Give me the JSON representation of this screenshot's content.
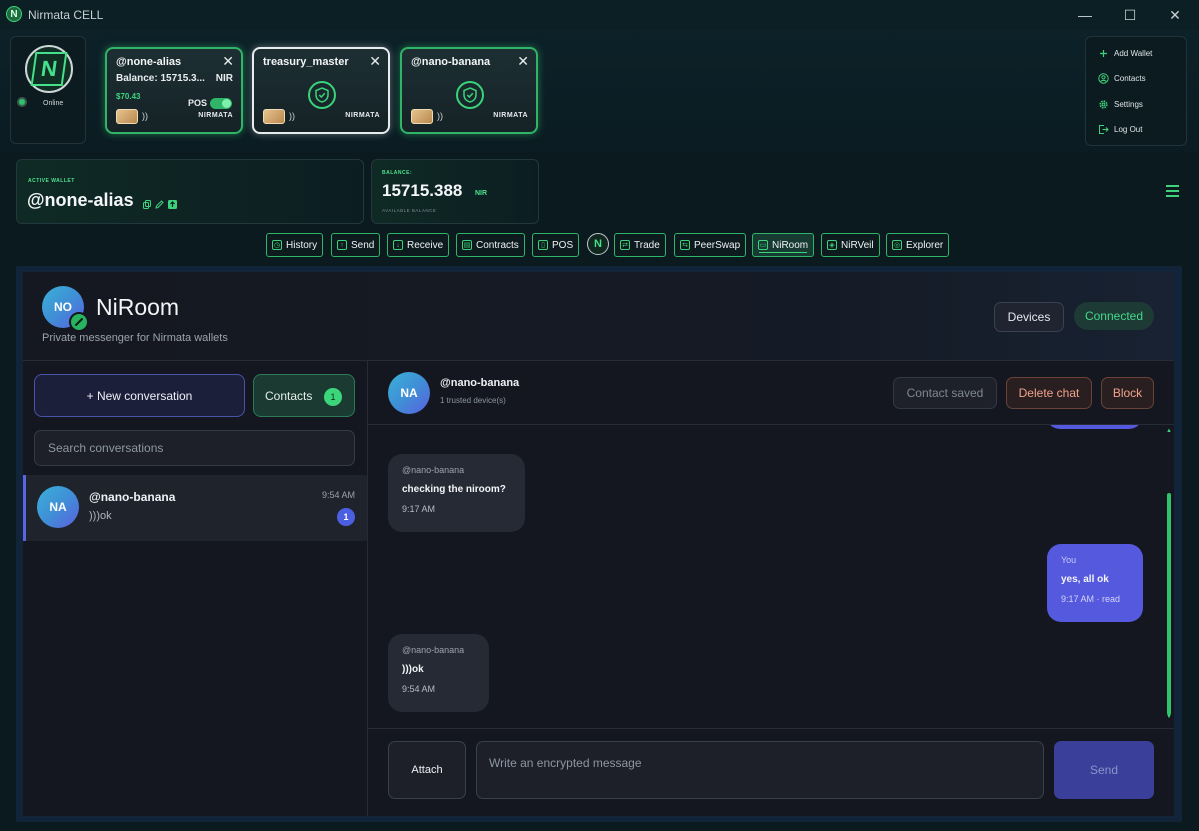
{
  "window": {
    "title": "Nirmata CELL",
    "app_icon_glyph": "N",
    "controls": {
      "minimize": "—",
      "maximize": "☐",
      "close": "✕"
    }
  },
  "node": {
    "logo_glyph": "N",
    "status": "Online",
    "status_color": "#2ec46b"
  },
  "wallets": [
    {
      "name": "@none-alias",
      "balance": "Balance: 15715.3...",
      "unit": "NIR",
      "usd": "$70.43",
      "pos_label": "POS",
      "pos_enabled": true,
      "wave": "))",
      "brand": "NIRMATA",
      "close": "✕"
    },
    {
      "name": "treasury_master",
      "wave": "))",
      "brand": "NIRMATA",
      "close": "✕"
    },
    {
      "name": "@nano-banana",
      "wave": "))",
      "brand": "NIRMATA",
      "close": "✕"
    }
  ],
  "menu": {
    "items": [
      {
        "icon": "plus-icon",
        "label": "Add Wallet"
      },
      {
        "icon": "user-circle-icon",
        "label": "Contacts"
      },
      {
        "icon": "gear-icon",
        "label": "Settings"
      },
      {
        "icon": "logout-icon",
        "label": "Log Out"
      }
    ]
  },
  "active_wallet": {
    "label": "ACTIVE WALLET",
    "alias": "@none-alias"
  },
  "balance": {
    "label": "BALANCE:",
    "amount": "15715.388",
    "unit": "NIR",
    "sub": "AVAILABLE BALANCE"
  },
  "nav": {
    "logo_glyph": "N",
    "items": [
      {
        "label": "History",
        "icon": "clock-icon",
        "glyph": "◷"
      },
      {
        "label": "Send",
        "icon": "arrow-up-icon",
        "glyph": "↑"
      },
      {
        "label": "Receive",
        "icon": "arrow-down-icon",
        "glyph": "↓"
      },
      {
        "label": "Contracts",
        "icon": "document-icon",
        "glyph": "▤"
      },
      {
        "label": "POS",
        "icon": "terminal-icon",
        "glyph": "▯"
      },
      {
        "label": "Trade",
        "icon": "swap-icon",
        "glyph": "⇄"
      },
      {
        "label": "PeerSwap",
        "icon": "peerswap-icon",
        "glyph": "⇆"
      },
      {
        "label": "NiRoom",
        "icon": "chat-icon",
        "glyph": "▭",
        "active": true
      },
      {
        "label": "NiRVeil",
        "icon": "shield-icon",
        "glyph": "◈"
      },
      {
        "label": "Explorer",
        "icon": "cube-icon",
        "glyph": "◎"
      }
    ]
  },
  "niroom": {
    "avatar_initials": "NO",
    "title": "NiRoom",
    "subtitle": "Private messenger for Nirmata wallets",
    "devices_label": "Devices",
    "status_label": "Connected",
    "status_color": "#45d78a"
  },
  "sidebar": {
    "new_conversation_label": "+ New conversation",
    "contacts_label": "Contacts",
    "contacts_count": "1",
    "search_placeholder": "Search conversations",
    "conversations": [
      {
        "initials": "NA",
        "name": "@nano-banana",
        "time": "9:54 AM",
        "preview": ")))ok",
        "unread": "1"
      }
    ]
  },
  "chat": {
    "initials": "NA",
    "name": "@nano-banana",
    "subtitle": "1 trusted device(s)",
    "contact_saved_label": "Contact saved",
    "delete_label": "Delete chat",
    "block_label": "Block",
    "messages": [
      {
        "direction": "in",
        "author": "@nano-banana",
        "text": "checking the niroom?",
        "time": "9:17 AM"
      },
      {
        "direction": "out",
        "author": "You",
        "text": "yes, all ok",
        "time": "9:17 AM · read"
      },
      {
        "direction": "in",
        "author": "@nano-banana",
        "text": ")))ok",
        "time": "9:54 AM"
      }
    ],
    "attach_label": "Attach",
    "input_placeholder": "Write an encrypted message",
    "send_label": "Send"
  }
}
